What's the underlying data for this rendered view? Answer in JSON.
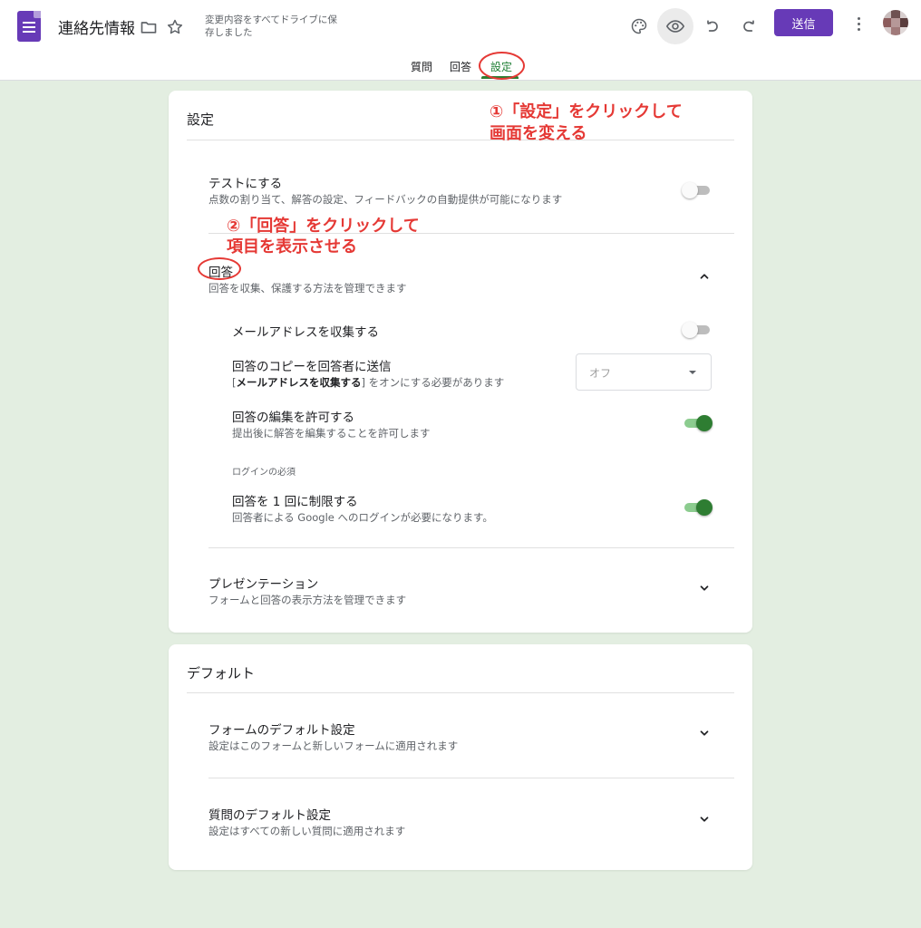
{
  "header": {
    "title": "連絡先情報",
    "saved_status": "変更内容をすべてドライブに保存しました",
    "send_label": "送信",
    "icons": [
      "forms-logo-icon",
      "folder-icon",
      "star-icon",
      "palette-icon",
      "eye-icon",
      "undo-icon",
      "redo-icon",
      "more-vert-icon"
    ]
  },
  "tabs": [
    {
      "label": "質問"
    },
    {
      "label": "回答"
    },
    {
      "label": "設定",
      "selected": true
    }
  ],
  "settings_card": {
    "title": "設定",
    "quiz": {
      "title": "テストにする",
      "subtitle": "点数の割り当て、解答の設定、フィードバックの自動提供が可能になります",
      "enabled": false
    },
    "responses": {
      "title": "回答",
      "subtitle": "回答を収集、保護する方法を管理できます",
      "expanded": true,
      "collect_email": {
        "title": "メールアドレスを収集する",
        "enabled": false
      },
      "send_copy": {
        "title": "回答のコピーを回答者に送信",
        "note_prefix": "[",
        "note_bold": "メールアドレスを収集する",
        "note_suffix": "] をオンにする必要があります",
        "select_value": "オフ"
      },
      "allow_edit": {
        "title": "回答の編集を許可する",
        "subtitle": "提出後に解答を編集することを許可します",
        "enabled": true
      },
      "login_required_label": "ログインの必須",
      "limit_one": {
        "title": "回答を 1 回に制限する",
        "subtitle": "回答者による Google へのログインが必要になります。",
        "enabled": true
      }
    },
    "presentation": {
      "title": "プレゼンテーション",
      "subtitle": "フォームと回答の表示方法を管理できます"
    }
  },
  "defaults_card": {
    "title": "デフォルト",
    "form_defaults": {
      "title": "フォームのデフォルト設定",
      "subtitle": "設定はこのフォームと新しいフォームに適用されます"
    },
    "question_defaults": {
      "title": "質問のデフォルト設定",
      "subtitle": "設定はすべての新しい質問に適用されます"
    }
  },
  "annotations": {
    "step1_line1": "①「設定」をクリックして",
    "step1_line2": "画面を変える",
    "step2_line1": "②「回答」をクリックして",
    "step2_line2": "項目を表示させる"
  },
  "colors": {
    "brand": "#673ab7",
    "accent_green": "#2e7d32",
    "background": "#e3eee1",
    "annotation": "#e53935"
  }
}
